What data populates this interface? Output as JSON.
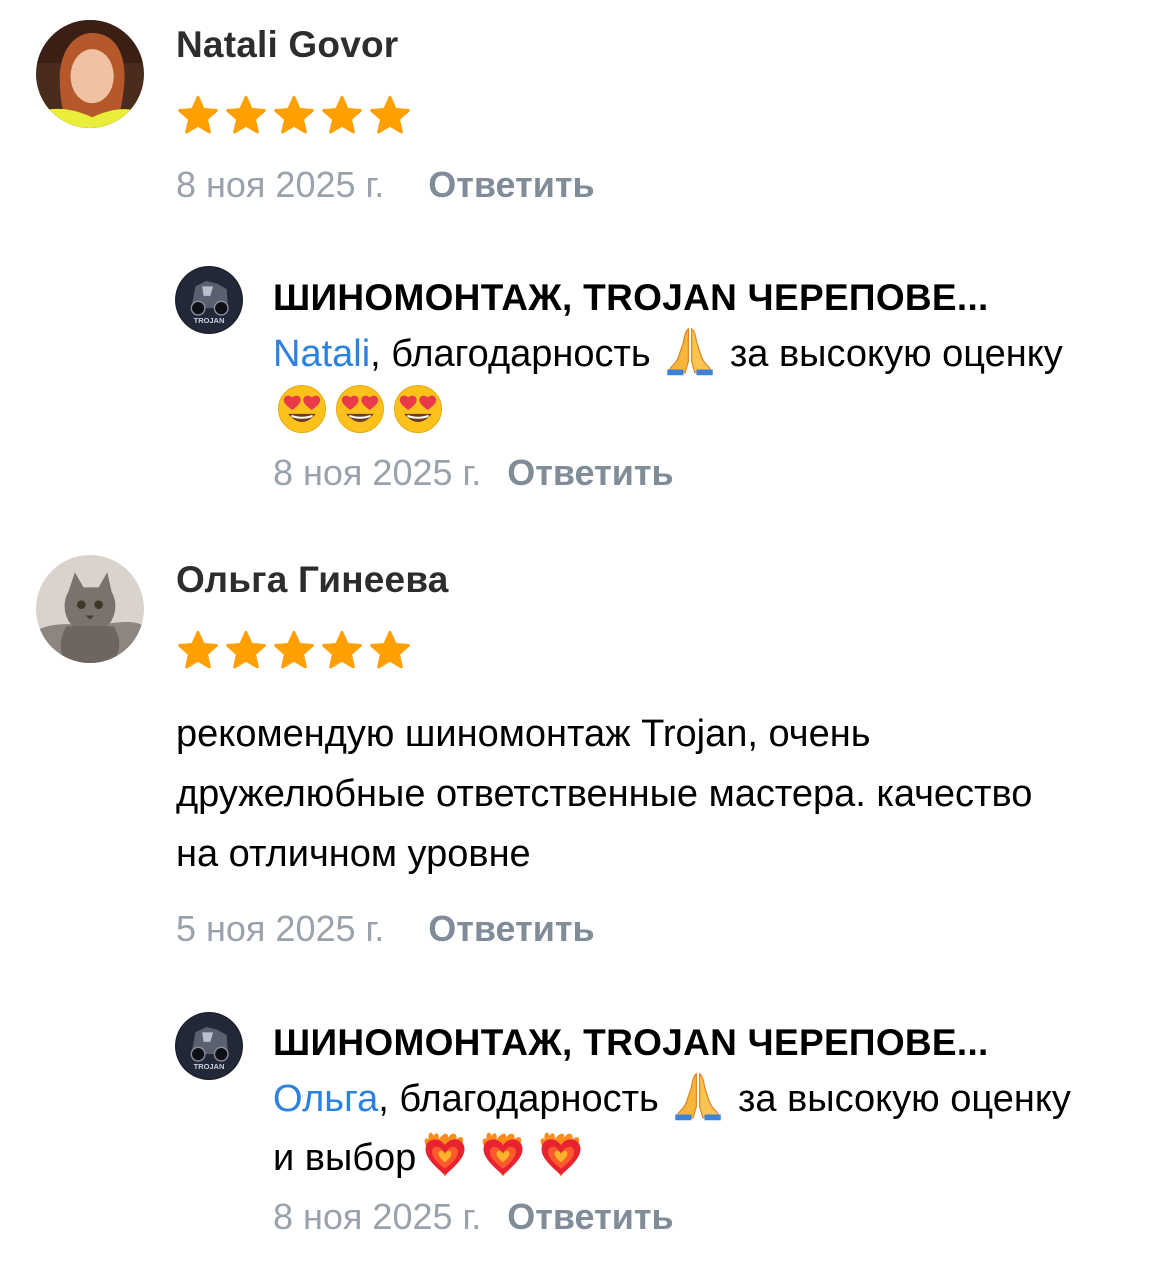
{
  "colors": {
    "star": "#ffa000",
    "mention": "#2d81e0",
    "meta_date": "#99a2ad",
    "reply_action": "#818c99",
    "author_name": "#2c2d2e"
  },
  "reviews": [
    {
      "author": "Natali Govor",
      "rating": 5,
      "text": "",
      "date": "8 ноя 2025 г.",
      "reply_label": "Ответить",
      "reply": {
        "author": "ШИНОМОНТАЖ, TROJAN ЧЕРЕПОВЕ...",
        "mention": "Natali",
        "text_part1": ", благодарность ",
        "text_part2": " за высокую оценку",
        "emojis": [
          "folded-hands",
          "heart-eyes",
          "heart-eyes",
          "heart-eyes"
        ],
        "date": "8 ноя 2025 г.",
        "reply_label": "Ответить"
      }
    },
    {
      "author": "Ольга Гинеева",
      "rating": 5,
      "text": "рекомендую шиномонтаж Trojan, очень дружелюбные ответственные мастера. качество на отличном уровне",
      "date": "5 ноя 2025 г.",
      "reply_label": "Ответить",
      "reply": {
        "author": "ШИНОМОНТАЖ, TROJAN ЧЕРЕПОВЕ...",
        "mention": "Ольга",
        "text_part1": ", благодарность ",
        "text_part2": " за высокую оценку и выбор",
        "emojis": [
          "folded-hands",
          "heart-on-fire",
          "heart-on-fire",
          "heart-on-fire"
        ],
        "date": "8 ноя 2025 г.",
        "reply_label": "Ответить"
      }
    }
  ]
}
